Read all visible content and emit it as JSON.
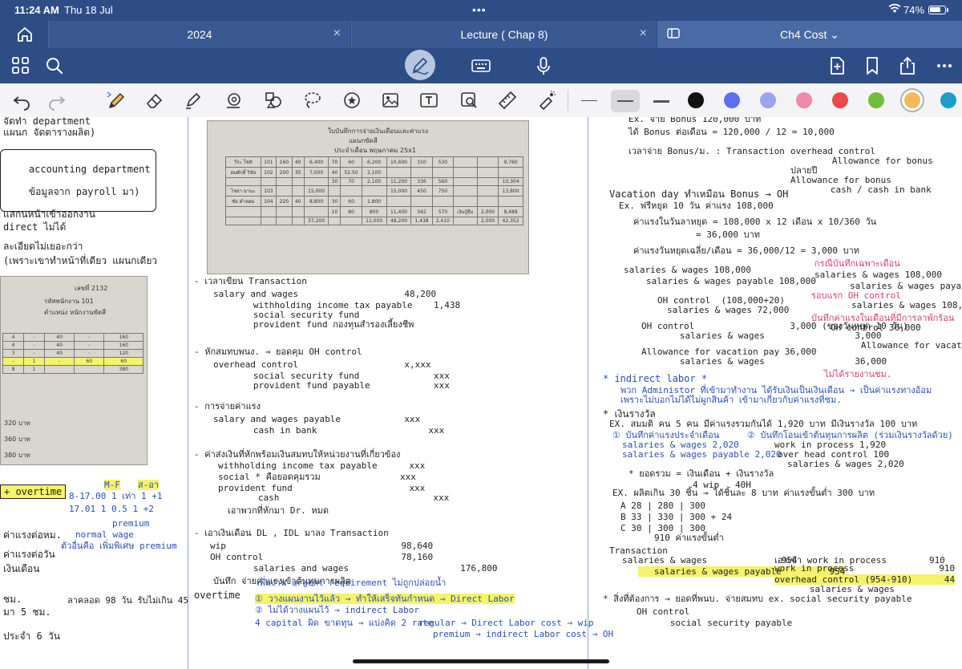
{
  "status_bar": {
    "time": "11:24 AM",
    "date": "Thu 18 Jul",
    "battery": "74%",
    "battery_level": 0.74,
    "multitask": "•••"
  },
  "tabs": [
    {
      "label": "2024",
      "close": "×"
    },
    {
      "label": "Lecture ( Chap 8)",
      "close": "×"
    },
    {
      "label": "Ch4 Cost ⌄"
    }
  ],
  "app_bar": {
    "icons": [
      "grid-icon",
      "search-icon",
      "pen-mode-icon",
      "keyboard-icon",
      "microphone-icon",
      "new-page-icon",
      "bookmark-icon",
      "share-icon",
      "more-icon"
    ]
  },
  "toolbar": {
    "tools": [
      "undo-icon",
      "redo-icon",
      "bluetooth-pen-icon",
      "eraser-icon",
      "highlighter-icon",
      "shapes-icon",
      "elements-icon",
      "lasso-icon",
      "stickers-icon",
      "image-icon",
      "text-icon",
      "camera-scan-icon",
      "ruler-icon",
      "laser-pointer-icon"
    ],
    "stroke_widths": [
      "thin",
      "medium",
      "thick"
    ],
    "selected_stroke": 1,
    "colors": [
      "#111111",
      "#5b6ff0",
      "#9aa4f2",
      "#ef8aa8",
      "#e94b4b",
      "#6fbf3a",
      "#f5b95a",
      "#1aa0c8"
    ],
    "selected_color": 6
  },
  "notes": {
    "left": {
      "lines": [
        "จัดทำ department",
        "แผนก จัดตารางผลิต)",
        "accounting department",
        "ข้อมูลจาก payroll มา)",
        "แสกนหน้าเข้าออกงาน",
        "direct ไม่ได้",
        "ละเอียดไม่เยอะกว่า",
        "(เพราะเขาทำหน้าที่เดียว แผนกเดียว",
        "+ overtime",
        "ค่าแรงต่อหม.",
        "ค่าแรงต่อวัน",
        "เงินเดือน",
        "ชม.",
        "มา 5 ชม.",
        "ประจำ 6 วัน",
        "ลาคลอด 98 วัน รับไม่เกิน 45"
      ],
      "card": {
        "number": "เลขที่ 2132",
        "employee_code": "รหัสพนักงาน 101",
        "position": "ตำแหน่ง หนักงานขัดสี",
        "rows": [
          [
            "4",
            "-",
            "40",
            "-",
            "160"
          ],
          [
            "4",
            "-",
            "40",
            "-",
            "160"
          ],
          [
            "3",
            "-",
            "40",
            "-",
            "120"
          ],
          [
            "-",
            "1",
            "-",
            "60",
            "60"
          ],
          [
            "8",
            "1",
            "",
            "",
            "380"
          ]
        ],
        "footer": [
          "320 บาท",
          "360 บาท",
          "380 บาท"
        ]
      },
      "ot_table": {
        "headers": [
          "M-F",
          "ส-อา"
        ],
        "rows": [
          [
            "8-17.00",
            "1 เท่า",
            "1",
            "+1"
          ],
          [
            "17.01",
            "1",
            "0.5",
            "1",
            "+2"
          ]
        ],
        "notes": [
          "premium",
          "normal wage",
          "ตัวอื่นคือ เพิ่มพิเศษ premium"
        ]
      }
    },
    "middle": {
      "photo_title": "ใบบันทึกการจ่ายเงินเดือนและค่าแรง",
      "photo_subtitle": "แผนกขัดสี",
      "photo_period": "ประจำเดือน พฤษภาคม 25x1",
      "photo_rows": [
        [
          "วีระ โชติ",
          "101",
          "160",
          "40",
          "6,400",
          "70",
          "60",
          "6,200",
          "10,600",
          "310",
          "530",
          "",
          "",
          "9,760"
        ],
        [
          "สมศักดิ์ วิชัย",
          "102",
          "200",
          "35",
          "7,000",
          "40",
          "52.50",
          "2,100",
          "",
          "",
          "",
          "",
          "",
          ""
        ],
        [
          "",
          "",
          "",
          "",
          "",
          "30",
          "70",
          "2,100",
          "11,200",
          "336",
          "560",
          "",
          "",
          "10,304"
        ],
        [
          "ไชยา มานะ",
          "103",
          "",
          "",
          "15,000",
          "",
          "",
          "",
          "15,000",
          "450",
          "750",
          "",
          "",
          "13,800"
        ],
        [
          "ชัย คำหอม",
          "104",
          "220",
          "40",
          "8,800",
          "30",
          "60",
          "1,800",
          "",
          "",
          "",
          "",
          "",
          ""
        ],
        [
          "",
          "",
          "",
          "",
          "",
          "10",
          "80",
          "800",
          "11,400",
          "342",
          "570",
          "เงินกู้ยืม",
          "2,000",
          "8,488"
        ],
        [
          "",
          "",
          "",
          "",
          "37,200",
          "",
          "",
          "11,000",
          "48,200",
          "1,438",
          "2,410",
          "",
          "2,000",
          "42,352"
        ]
      ],
      "entries": [
        "- เวลาเขียน Transaction",
        "salary and wages                    48,200",
        "   withholding income tax payable    1,438",
        "   social security fund",
        "   provident fund กองทุนสำรองเลี้ยงชีพ",
        "- หักสมทบพนง. → ยอดคุม OH control",
        "overhead control                    x,xxx",
        "   social security fund              xxx",
        "   provident fund payable            xxx",
        "- การจ่ายค่าแรง",
        "salary and wages payable            xxx",
        "   cash in bank                     xxx",
        "- ค่าส่งเงินที่หักพร้อมเงินสมทบให้หน่วยงานที่เกี่ยวข้อง",
        "withholding income tax payable      xxx",
        "social * คือยอดคุมรวม               xxx",
        "provident fund                      xxx",
        "   cash                             xxx",
        "เอาพวกที่หักมา Dr. หมด",
        "- เอาเงินเดือน DL , IDL มาลง Transaction",
        "wip                                 98,640",
        "OH control                          78,160",
        "   salaries and wages                     176,800",
        "บันทึก จ่ายค่าแรงเข้าต้นทุนการผลิต",
        "overtime",
        "เพิ่มงาน urgent requirement ไม่ถูกปล่อยน้ำ",
        "① วางแผนงานไว้แล้ว → ทำให้เสร็จทันกำหนด ⇒ Direct Labor",
        "② ไม่ได้วางแผนไว้ → indirect Labor",
        "4 capital ผิด ขาดทุน → แบ่งคิด 2 rate",
        "regular → Direct Labor cost → wip",
        "premium → indirect Labor cost → OH"
      ]
    },
    "right": {
      "entries": [
        "Ex. จ่าย Bonus 120,000 บาท",
        "ได้ Bonus ต่อเดือน = 120,000 / 12 = 10,000",
        "เวลาจ่าย Bonus/ม. : Transaction",
        "overhead control                    10,000",
        "   Allowance for bonus                    10,000",
        "ปลายปี",
        "Allowance for bonus                 120,000",
        "   cash / cash in bank                    120,000",
        "Vacation day ทำเหมือน Bonus → OH",
        "Ex. ฟรีหยุด 10 วัน ค่าแรง 108,000",
        "ค่าแรงในวันลาหยุด = 108,000 x 12 เดือน x 10/360 วัน",
        "= 36,000 บาท",
        "ค่าแรงวันหยุดเฉลี่ย/เดือน = 36,000/12 = 3,000 บาท",
        "salaries & wages 108,000",
        "salaries & wages payable 108,000",
        "OH control  (108,000+20)",
        "salaries & wages 72,000",
        "OH control                  3,000 (ของวันหยุด 10 วัน)",
        "   salaries & wages                 3,000",
        "Allowance for vacation pay 36,000",
        "   salaries & wages                 36,000",
        "กรณีบันทึกเฉพาะเดือน",
        "salaries & wages 108,000",
        "salaries & wages payable 108,000",
        "รอบแรก OH control",
        "salaries & wages 108,000",
        "บันทึกค่าแรงในเดือนที่มีการลาพักร้อน",
        "OH control 36,000",
        "   Allowance for vacation pay",
        "* indirect labor *",
        "พวก Administor ที่เข้ามาทำงาน ได้รับเงินเป็นเงินเดือน → เป็นค่าแรงทางอ้อม",
        "ไม่ได้รายงานชม.",
        "เพราะไม่บอกไม่ได้ไม่ผูกสินค้า เข้ามาเกี่ยวกับค่าแรงที่ชม.",
        "* เงินรางวัล",
        "EX. สมมติ คน 5 คน มีค่าแรงรวมกันได้ 1,920 บาท มีเงินรางวัล 100 บาท",
        "① บันทึกค่าแรงประจำเดือน",
        "salaries & wages 2,020",
        "salaries & wages payable 2,020",
        "② บันทึกโอนเข้าต้นทุนการผลิต (ร่วมเงินรางวัลด้วย)",
        "work in process 1,920",
        "over head control 100",
        "salaries & wages 2,020",
        "* ยอดรวม = เงินเดือน + เงินรางวัล",
        "4 wip   40H",
        "EX. ผลิตเกิน 30 ชิ้น → ได้ชิ้นละ 8 บาท ค่าแรงขั้นต่ำ 300 บาท",
        "A 28 | 280 | 300",
        "B 33 | 330 | 300 + 24",
        "C 30 | 300 | 300",
        "910 ค่าแรงขั้นต่ำ",
        "Transaction",
        "salaries & wages              954",
        "   salaries & wages payable         954",
        "เอาเข้า work in process        910",
        "work in process                910",
        "overhead control (954-910)      44",
        "   salaries & wages                 954",
        "* สิ่งที่ต้องการ → ยอดที่พนบ. จ่ายสมทบ ex. social security payable",
        "OH control",
        "   social security payable"
      ]
    }
  }
}
